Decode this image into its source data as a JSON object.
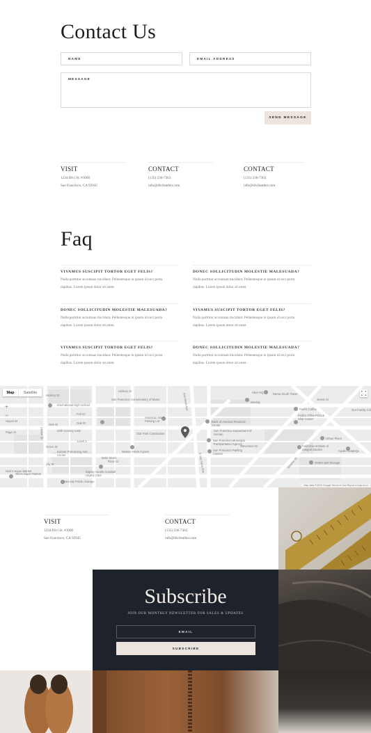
{
  "contact": {
    "title": "Contact Us",
    "name_label": "NAME",
    "email_label": "EMAIL ADDRESS",
    "message_label": "MESSAGE",
    "send_label": "SEND MESSAGE"
  },
  "info_top": [
    {
      "heading": "VISIT",
      "line1": "1234 Divi St. #1000",
      "line2": "San Francisco, CA 93945"
    },
    {
      "heading": "CONTACT",
      "line1": "(135) 236-7363",
      "line2": "info@divileather.com"
    },
    {
      "heading": "CONTACT",
      "line1": "(135) 236-7363",
      "line2": "info@divileather.com"
    }
  ],
  "faq": {
    "title": "Faq",
    "items": [
      {
        "q": "VIVAMUS SUSCIPIT TORTOR EGET FELIS?",
        "a1": "Nulla porttitor accumsan tincidunt. Pellentesque in ipsum id orci porta",
        "a2": "dapibus. Lorem ipsum dolor sit amet."
      },
      {
        "q": "DONEC SOLLICITUDIN MOLESTIE MALESUADA?",
        "a1": "Nulla porttitor accumsan tincidunt. Pellentesque in ipsum id orci porta",
        "a2": "dapibus. Lorem ipsum dolor sit amet."
      },
      {
        "q": "DONEC SOLLICITUDIN MOLESTIE MALESUADA?",
        "a1": "Nulla porttitor accumsan tincidunt. Pellentesque in ipsum id orci porta",
        "a2": "dapibus. Lorem ipsum dolor sit amet."
      },
      {
        "q": "VIVAMUS SUSCIPIT TORTOR EGET FELIS?",
        "a1": "Nulla porttitor accumsan tincidunt. Pellentesque in ipsum id orci porta",
        "a2": "dapibus. Lorem ipsum dolor sit amet."
      },
      {
        "q": "VIVAMUS SUSCIPIT TORTOR EGET FELIS?",
        "a1": "Nulla porttitor accumsan tincidunt. Pellentesque in ipsum id orci porta",
        "a2": "dapibus. Lorem ipsum dolor sit amet."
      },
      {
        "q": "DONEC SOLLICITUDIN MOLESTIE MALESUADA?",
        "a1": "Nulla porttitor accumsan tincidunt. Pellentesque in ipsum id orci porta",
        "a2": "dapibus. Lorem ipsum dolor sit amet."
      }
    ]
  },
  "map": {
    "tab_map": "Map",
    "tab_satellite": "Satellite",
    "zoom_in": "+",
    "zoom_out": "−",
    "fullscreen_icon": "fullscreen-icon",
    "pin_icon": "map-pin-icon",
    "labels": [
      "Hickory St",
      "San Francisco Conservatory of Music",
      "International High School",
      "Oak St",
      "20th Century Cafe",
      "Otto's Super Market",
      "Hayes St",
      "Fell St",
      "Oak St",
      "Star Park Corporation",
      "American Wash Parking Lot",
      "Bank of America Financial Center",
      "San Francisco Department of Human",
      "San Francisco Municipal Transportation Agency",
      "San Francisco Parking Citation",
      "Market Street Cycles",
      "Beltz Strets",
      "Dignity Health Goodwill Urgent Care",
      "Security Public Storage",
      "Nick's Super Market",
      "Kanbar Performing Arts Center",
      "Level 1",
      "Uber HQ",
      "Nema South Tower",
      "Weebly",
      "Peet's Coffee",
      "FedEx Office Print & Ship Center",
      "Urban Place",
      "California Institute of Integral Studies",
      "SOMA Self Storage",
      "Apollo GraphQL",
      "Our Family Col",
      "Mission St",
      "S Van Ness Ave",
      "Van Ness Ave",
      "Linden St",
      "Rose St",
      "Page St",
      "Lily St",
      "Hickory St",
      "Stevenson St",
      "Jessie St",
      "Grove St"
    ],
    "attribution": "Map data ©2023 Google   Terms of Use   Report a map error"
  },
  "info_bottom": [
    {
      "heading": "VISIT",
      "line1": "1234 Divi St. #1000",
      "line2": "San Francisco, CA 93945"
    },
    {
      "heading": "CONTACT",
      "line1": "(135) 236-7363",
      "line2": "info@divileather.com"
    }
  ],
  "subscribe": {
    "title": "Subscribe",
    "text": "JOIN OUR MONTHLY NEWSLETTER FOR SALES & UPDATES",
    "email_label": "EMAIL",
    "button_label": "SUBSCRIBE"
  },
  "colors": {
    "dark_panel": "#1e222b",
    "accent_beige": "#ece4df",
    "leather_brown": "#8a5a35",
    "brass": "#b8953a"
  }
}
